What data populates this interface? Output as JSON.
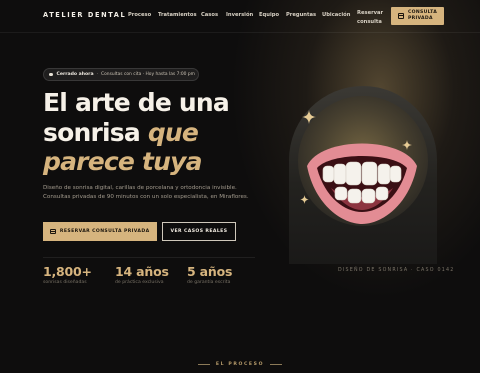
{
  "nav": {
    "brand": "ATELIER DENTAL",
    "links": [
      "Proceso",
      "Tratamientos",
      "Casos",
      "Inversión",
      "Equipo",
      "Preguntas",
      "Ubicación"
    ],
    "reserve_label": "Reservar consulta",
    "cta_label": "CONSULTA PRIVADA"
  },
  "status": {
    "state": "Cerrado ahora",
    "separator": "·",
    "info": "Consultas con cita · Hoy hasta las 7:00 pm"
  },
  "hero": {
    "title_plain": "El arte de una sonrisa",
    "title_accent_1": "que",
    "title_accent_2": "parece tuya",
    "lead": "Diseño de sonrisa digital, carillas de porcelana y ortodoncia invisible. Consultas privadas de 90 minutos con un solo especialista, en Miraflores.",
    "primary_cta": "RESERVAR CONSULTA PRIVADA",
    "secondary_cta": "VER CASOS REALES"
  },
  "stats": [
    {
      "value": "1,800+",
      "caption": "sonrisas diseñadas"
    },
    {
      "value": "14 años",
      "caption": "de práctica exclusiva"
    },
    {
      "value": "5 años",
      "caption": "de garantía escrita"
    }
  ],
  "art": {
    "caption": "DISEÑO DE SONRISA · CASO 0142"
  },
  "section": {
    "label": "EL PROCESO"
  },
  "colors": {
    "background": "#0e0d0d",
    "accent_gold": "#d6b47e",
    "lip_pink": "#e38c94",
    "text_light": "#f6f1e8"
  }
}
